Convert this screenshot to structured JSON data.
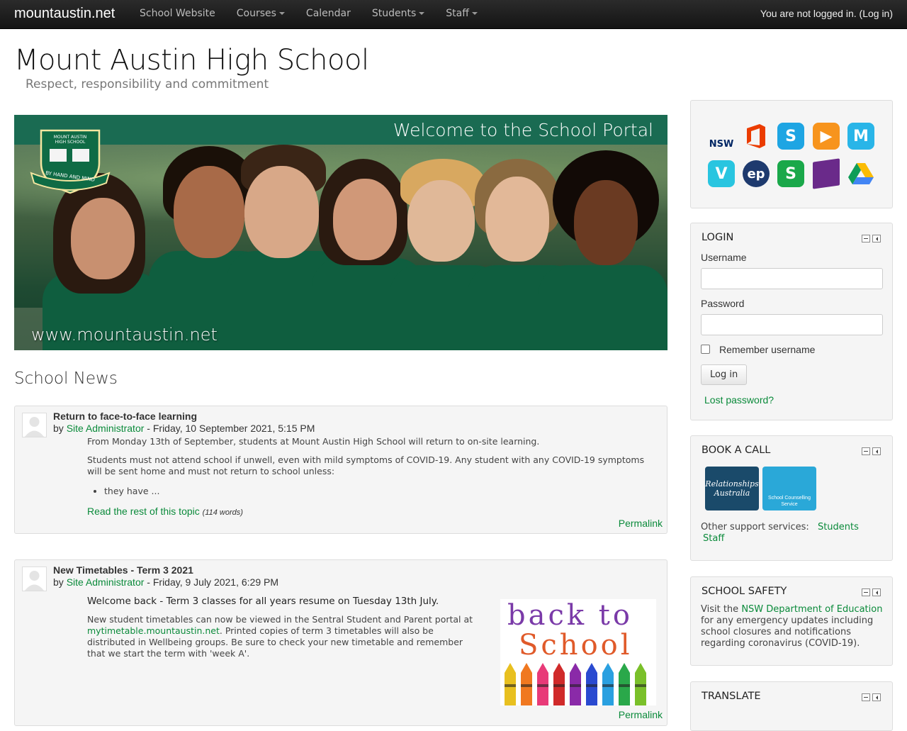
{
  "navbar": {
    "brand": "mountaustin.net",
    "items": [
      {
        "label": "School Website",
        "dropdown": false
      },
      {
        "label": "Courses",
        "dropdown": true
      },
      {
        "label": "Calendar",
        "dropdown": false
      },
      {
        "label": "Students",
        "dropdown": true
      },
      {
        "label": "Staff",
        "dropdown": true
      }
    ],
    "login_status": "You are not logged in.",
    "login_link": "(Log in)"
  },
  "header": {
    "title": "Mount Austin High School",
    "tagline": "Respect, responsibility and commitment"
  },
  "banner": {
    "title": "Welcome to the School Portal",
    "url": "www.mountaustin.net",
    "crest_top": "MOUNT AUSTIN",
    "crest_mid": "HIGH SCHOOL",
    "crest_motto": "BY HAND AND MIND"
  },
  "news": {
    "heading": "School News",
    "posts": [
      {
        "subject": "Return to face-to-face learning",
        "by_prefix": "by",
        "author": "Site Administrator",
        "date": "- Friday, 10 September 2021, 5:15 PM",
        "p1": "From Monday 13th of September, students at Mount Austin High School will return to on-site learning.",
        "p2": "Students must not attend school if unwell, even with mild symptoms of COVID-19. Any student with any COVID-19 symptoms will be sent home and must not return to school unless:",
        "bullet": "they have ...",
        "read_more": "Read the rest of this topic",
        "word_count": "(114 words)",
        "permalink": "Permalink"
      },
      {
        "subject": "New Timetables - Term 3 2021",
        "by_prefix": "by",
        "author": "Site Administrator",
        "date": "- Friday, 9 July 2021, 6:29 PM",
        "lead": "Welcome back - Term 3 classes for all years resume on Tuesday 13th July.",
        "p_start": "New student timetables can now be viewed in the Sentral Student and Parent portal at ",
        "p_link": "mytimetable.mountaustin.net",
        "p_end": ". Printed copies of term 3 timetables will also be distributed in Wellbeing groups. Be sure to check your new timetable and remember that we start the term with 'week A'.",
        "image_line1": "back to",
        "image_line2": "School",
        "permalink": "Permalink"
      }
    ]
  },
  "apps": [
    {
      "name": "nsw-icon",
      "label": "NSW",
      "color": "#d7153a"
    },
    {
      "name": "office-icon",
      "label": "",
      "color": "#eb3c00"
    },
    {
      "name": "sentral-icon",
      "label": "S",
      "color": "#1ea5e3"
    },
    {
      "name": "play-icon",
      "label": "▶",
      "color": "#f7941d"
    },
    {
      "name": "mathspace-icon",
      "label": "M",
      "color": "#29b5e8"
    },
    {
      "name": "vivi-icon",
      "label": "V",
      "color": "#29c5e0"
    },
    {
      "name": "education-perfect-icon",
      "label": "ep",
      "color": "#1e3a6e"
    },
    {
      "name": "stile-icon",
      "label": "S",
      "color": "#1aa84a"
    },
    {
      "name": "book-icon",
      "label": "",
      "color": "#6a2a8a"
    },
    {
      "name": "google-drive-icon",
      "label": "",
      "color": "#fbbc04"
    }
  ],
  "login_block": {
    "title": "LOGIN",
    "username_label": "Username",
    "password_label": "Password",
    "remember_label": "Remember username",
    "login_button": "Log in",
    "lost_password": "Lost password?"
  },
  "book_call": {
    "title": "BOOK A CALL",
    "tile1": "Relationships Australia",
    "tile2": "School Counselling Service",
    "support_prefix": "Other support services:",
    "students_link": "Students",
    "staff_link": "Staff"
  },
  "safety": {
    "title": "SCHOOL SAFETY",
    "text_start": "Visit the ",
    "link": "NSW Department of Education",
    "text_end": " for any emergency updates including school closures and notifications regarding coronavirus (COVID-19)."
  },
  "translate": {
    "title": "TRANSLATE"
  }
}
